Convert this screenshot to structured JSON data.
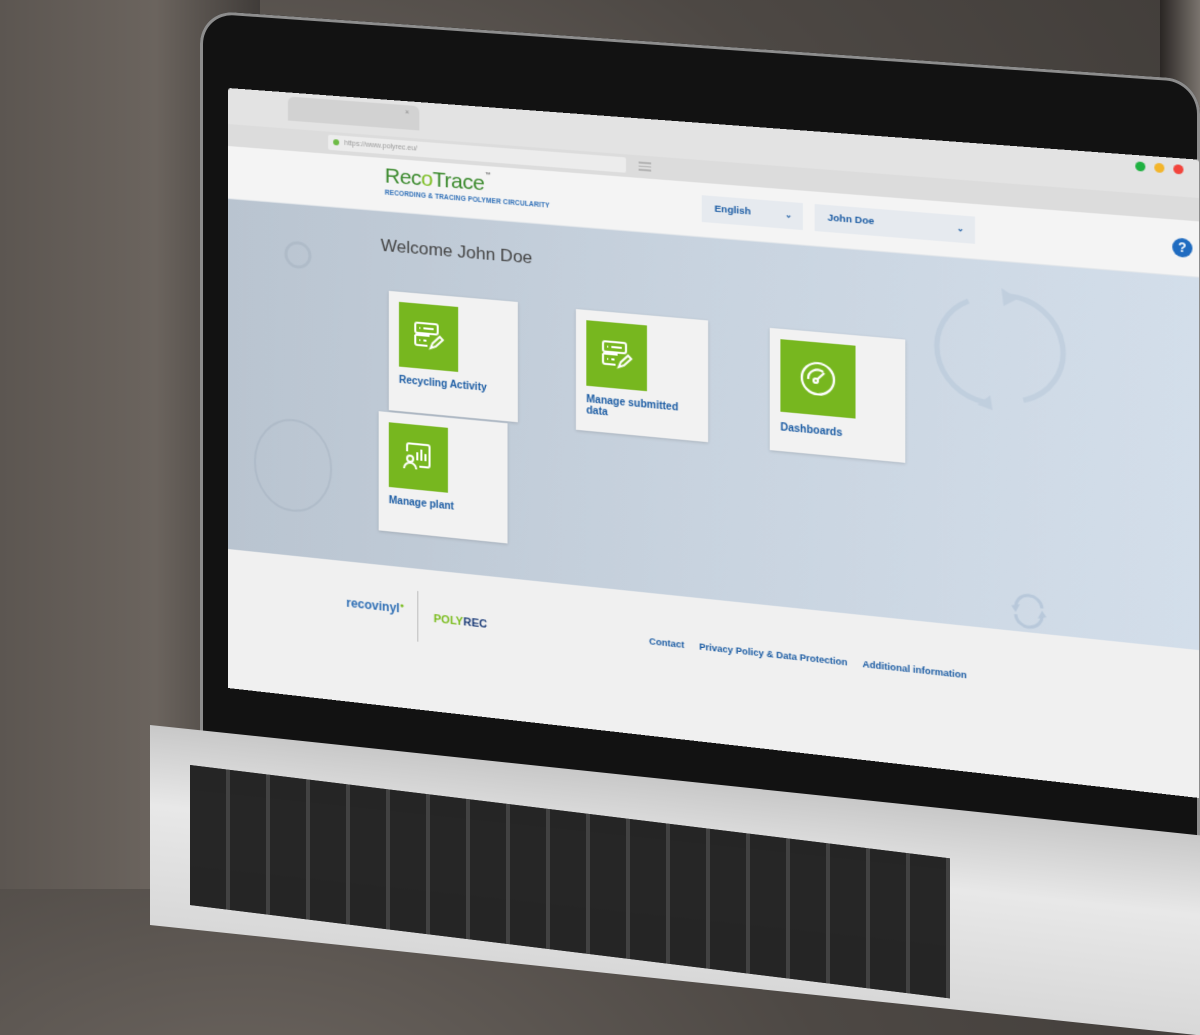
{
  "browser": {
    "url": "https://www.polyrec.eu/",
    "window_controls": [
      "green",
      "yellow",
      "red"
    ],
    "window_control_colors": {
      "green": "#1fb141",
      "yellow": "#f3b52b",
      "red": "#f2443c"
    }
  },
  "header": {
    "logo_text_a": "Rec",
    "logo_text_o": "o",
    "logo_text_b": "Trace",
    "logo_tm": "™",
    "logo_tagline": "RECORDING & TRACING POLYMER CIRCULARITY",
    "language_select": {
      "value": "English",
      "chevron": "chevron-down-icon"
    },
    "user_select": {
      "value": "John Doe",
      "chevron": "chevron-down-icon"
    },
    "help_button": "?"
  },
  "main": {
    "welcome": "Welcome John Doe",
    "cards": [
      {
        "label": "Recycling Activity",
        "icon": "form-edit-icon"
      },
      {
        "label": "Manage submitted data",
        "icon": "form-edit-icon"
      },
      {
        "label": "Dashboards",
        "icon": "gauge-icon"
      },
      {
        "label": "Manage plant",
        "icon": "presentation-chart-icon"
      }
    ]
  },
  "footer": {
    "logo_recovinyl": "recovinyl",
    "logo_polyrec_a": "POLY",
    "logo_polyrec_b": "REC",
    "links": [
      "Contact",
      "Privacy Policy & Data Protection",
      "Additional information"
    ]
  },
  "colors": {
    "brand_green": "#77b71f",
    "link_blue": "#1a5ba3",
    "help_blue": "#1f6bc0",
    "content_bg": "#c8d3df"
  },
  "chevron_glyph": "⌄"
}
